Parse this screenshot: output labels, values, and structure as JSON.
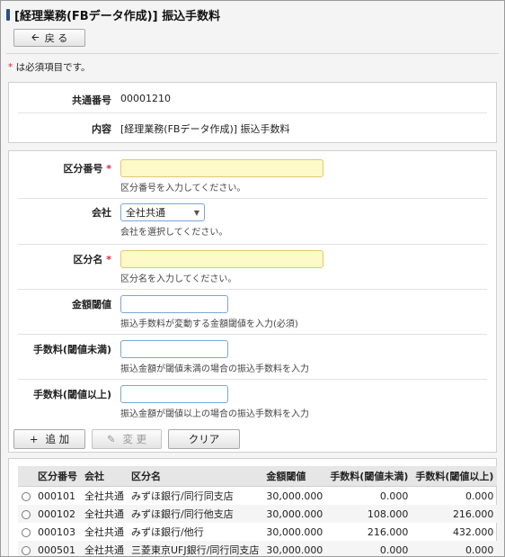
{
  "title": "[経理業務(FBデータ作成)] 振込手数料",
  "back_button": {
    "icon": "arrow-left-icon",
    "label": "戻 る"
  },
  "required_note": {
    "mark": "*",
    "text": " は必須項目です。"
  },
  "info": {
    "common_no_label": "共通番号",
    "common_no_value": "00001210",
    "content_label": "内容",
    "content_value": "[経理業務(FBデータ作成)] 振込手数料"
  },
  "form": {
    "division_no": {
      "label": "区分番号",
      "value": "",
      "hint": "区分番号を入力してください。"
    },
    "company": {
      "label": "会社",
      "selected": "全社共通",
      "hint": "会社を選択してください。"
    },
    "division_name": {
      "label": "区分名",
      "value": "",
      "hint": "区分名を入力してください。"
    },
    "amount_threshold": {
      "label": "金額閾値",
      "value": "",
      "hint": "振込手数料が変動する金額閾値を入力(必須)"
    },
    "fee_below": {
      "label": "手数料(閾値未満)",
      "value": "",
      "hint": "振込金額が閾値未満の場合の振込手数料を入力"
    },
    "fee_above": {
      "label": "手数料(閾値以上)",
      "value": "",
      "hint": "振込金額が閾値以上の場合の振込手数料を入力"
    },
    "required_mark": "*"
  },
  "actions": {
    "add": {
      "icon": "plus-icon",
      "label": "追 加"
    },
    "edit": {
      "icon": "pencil-icon",
      "label": "変 更"
    },
    "clear": {
      "label": "クリア"
    }
  },
  "table": {
    "headers": [
      "",
      "区分番号",
      "会社",
      "区分名",
      "金額閾値",
      "手数料(閾値未満)",
      "手数料(閾値以上)"
    ],
    "rows": [
      {
        "no": "000101",
        "company": "全社共通",
        "name": "みずほ銀行/同行同支店",
        "threshold": "30,000.000",
        "below": "0.000",
        "above": "0.000"
      },
      {
        "no": "000102",
        "company": "全社共通",
        "name": "みずほ銀行/同行他支店",
        "threshold": "30,000.000",
        "below": "108.000",
        "above": "216.000"
      },
      {
        "no": "000103",
        "company": "全社共通",
        "name": "みずほ銀行/他行",
        "threshold": "30,000.000",
        "below": "216.000",
        "above": "432.000"
      },
      {
        "no": "000501",
        "company": "全社共通",
        "name": "三菱東京UFJ銀行/同行同支店",
        "threshold": "30,000.000",
        "below": "0.000",
        "above": "0.000"
      }
    ]
  },
  "colors": {
    "title_mark": "#2b4f86",
    "required": "#e0203a",
    "input_required_bg": "#fdf9c8",
    "input_border": "#7aa6d8"
  }
}
